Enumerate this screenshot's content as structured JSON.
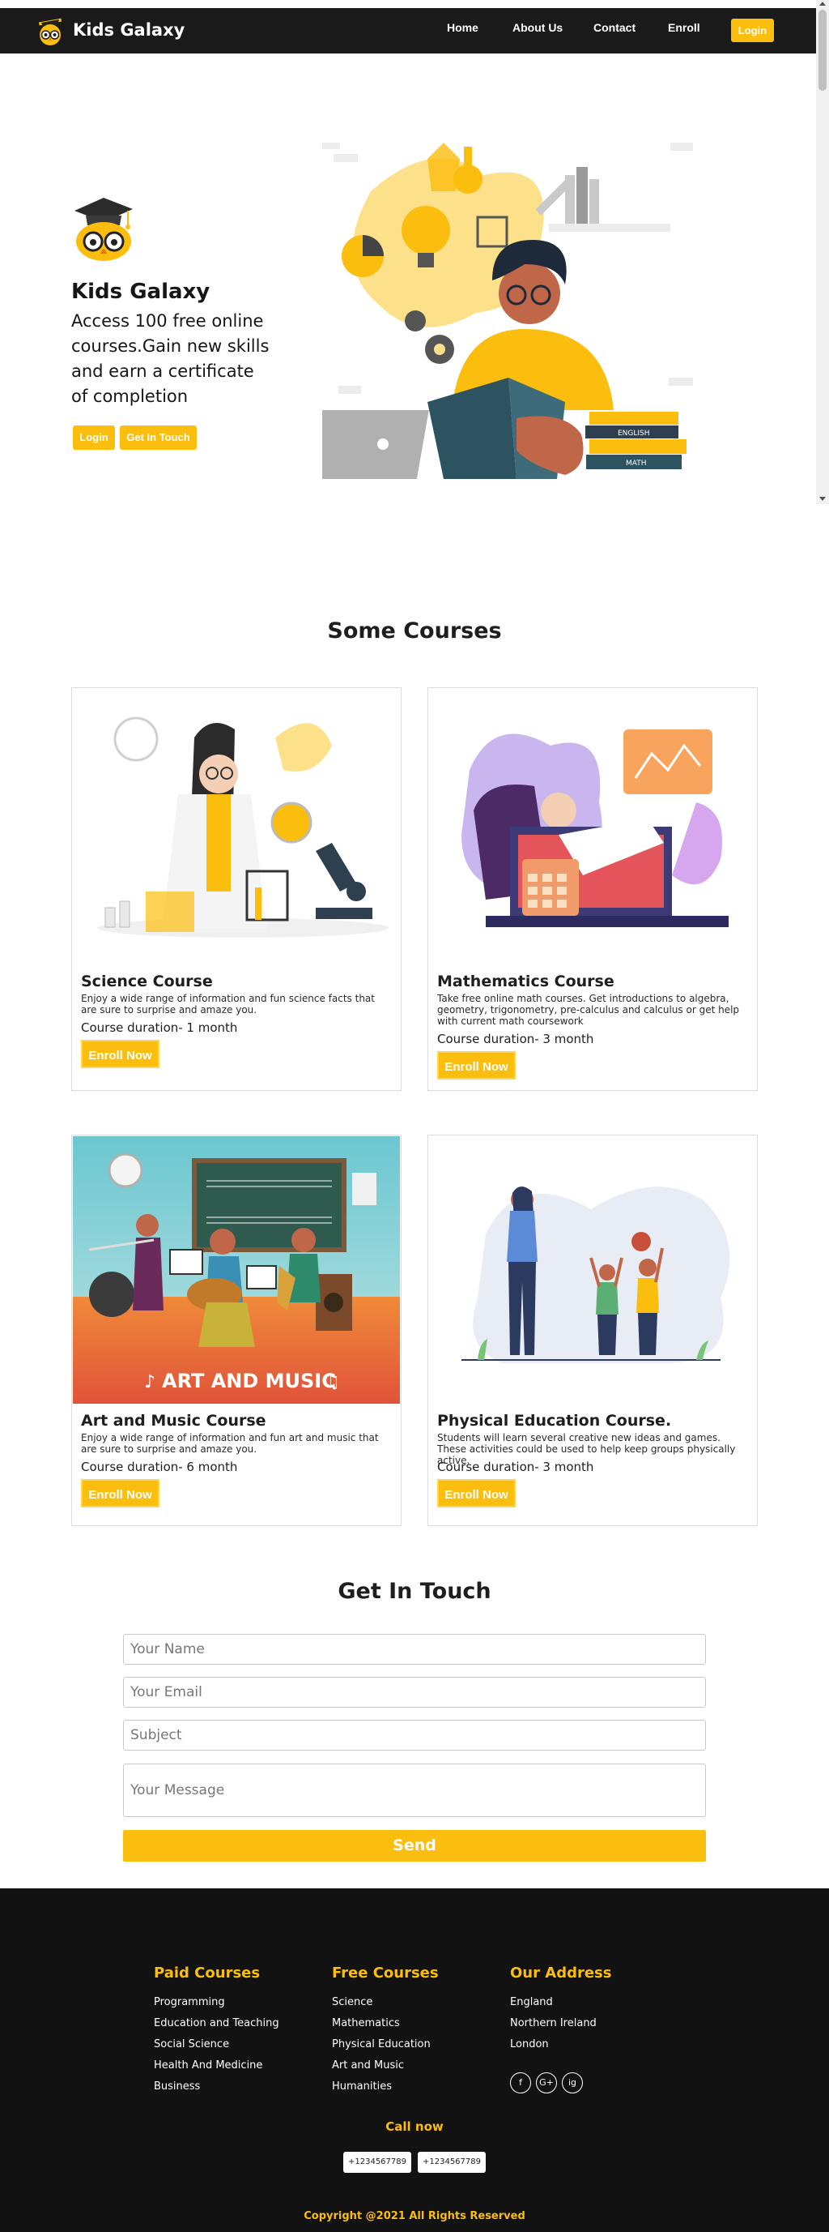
{
  "brand": {
    "name": "Kids Galaxy"
  },
  "nav": {
    "links": [
      "Home",
      "About Us",
      "Contact",
      "Enroll"
    ],
    "login_label": "Login"
  },
  "hero": {
    "title": "Kids Galaxy",
    "text": "Access 100 free online courses.Gain new skills and earn a certificate of completion",
    "login_label": "Login",
    "touch_label": "Get In Touch",
    "book_labels": [
      "ENGLISH",
      "MATH"
    ]
  },
  "courses_section": {
    "title": "Some Courses",
    "enroll_label": "Enroll Now",
    "courses": [
      {
        "title": "Science Course",
        "desc": "Enjoy a wide range of information and fun science facts that are sure to surprise and amaze you.",
        "duration": "Course duration- 1 month"
      },
      {
        "title": "Mathematics Course",
        "desc": "Take free online math courses. Get introductions to algebra, geometry, trigonometry, pre-calculus and calculus or get help with current math coursework",
        "duration": "Course duration- 3 month"
      },
      {
        "title": "Art and Music Course",
        "desc": "Enjoy a wide range of information and fun art and music that are sure to surprise and amaze you.",
        "duration": "Course duration- 6 month",
        "banner": "ART AND MUSIC"
      },
      {
        "title": "Physical Education Course.",
        "desc": "Students will learn several creative new ideas and games. These activities could be used to help keep groups physically active.",
        "duration": "Course duration- 3 month"
      }
    ]
  },
  "contact": {
    "title": "Get In Touch",
    "name_placeholder": "Your Name",
    "email_placeholder": "Your Email",
    "subject_placeholder": "Subject",
    "message_placeholder": "Your Message",
    "send_label": "Send"
  },
  "footer": {
    "paid_title": "Paid Courses",
    "paid_items": [
      "Programming",
      "Education and Teaching",
      "Social Science",
      "Health And Medicine",
      "Business"
    ],
    "free_title": "Free Courses",
    "free_items": [
      "Science",
      "Mathematics",
      "Physical Education",
      "Art and Music",
      "Humanities"
    ],
    "address_title": "Our Address",
    "address_items": [
      "England",
      "Northern Ireland",
      "London"
    ],
    "social": [
      "f",
      "G+",
      "ig"
    ],
    "call_title": "Call now",
    "phones": [
      "+1234567789",
      "+1234567789"
    ],
    "copyright": "Copyright @2021 All Rights Reserved"
  },
  "colors": {
    "accent": "#fbbd0e",
    "nav_bg": "#1a1a1a",
    "footer_bg": "#121212"
  }
}
